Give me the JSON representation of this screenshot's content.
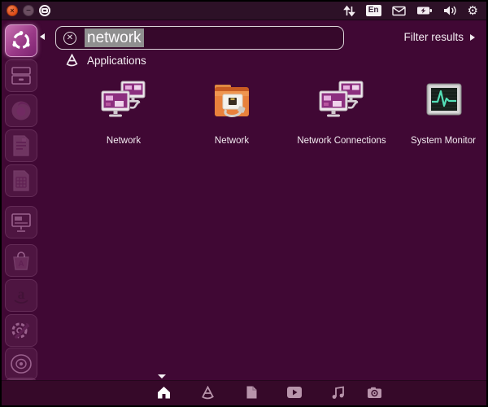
{
  "panel": {
    "window_controls": {
      "close": "×",
      "minimize": "–",
      "maximize": "restore"
    },
    "keyboard_layout": "En",
    "indicator_icons": [
      "updown-arrows",
      "keyboard-layout",
      "mail",
      "battery",
      "volume",
      "settings-gear"
    ],
    "gear_glyph": "⚙"
  },
  "search": {
    "value": "network",
    "clear_glyph": "✕",
    "filter_label": "Filter results"
  },
  "results_header": {
    "label": "Applications"
  },
  "results": [
    {
      "label": "Network",
      "icon": "network-computers"
    },
    {
      "label": "Network",
      "icon": "network-folder"
    },
    {
      "label": "Network Connections",
      "icon": "network-computers"
    },
    {
      "label": "System Monitor",
      "icon": "system-monitor"
    }
  ],
  "launcher": {
    "items": [
      "ubuntu-dash-home",
      "files",
      "firefox",
      "libreoffice-writer",
      "libreoffice-calc",
      "libreoffice-impress",
      "software-center",
      "amazon",
      "system-settings",
      "workspace-switcher",
      "trash"
    ],
    "amazon_glyph": "a"
  },
  "bottom_bar": {
    "lenses": [
      "home",
      "applications",
      "files",
      "videos",
      "music",
      "photos"
    ]
  },
  "colors": {
    "dash_bg": "#400834",
    "panel_bg": "#2d1127",
    "bottom_bar_bg": "#360929",
    "close_orange": "#dd4814",
    "selection_gray": "#8f8f8f",
    "folder_orange": "#e8813c",
    "monitor_screen_purple": "#8c2f7f",
    "heartbeat_teal": "#54e0b8"
  }
}
